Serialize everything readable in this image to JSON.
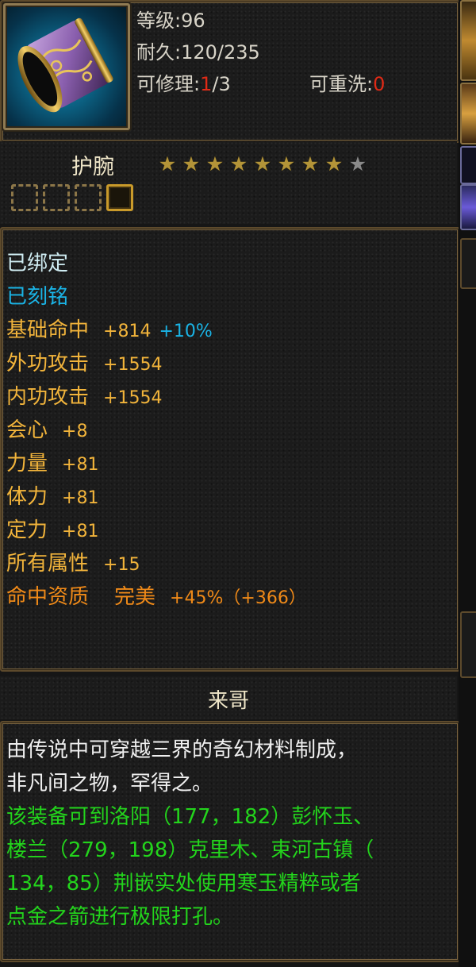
{
  "header": {
    "level_label": "等级",
    "level_value": "96",
    "durability_label": "耐久",
    "durability_value": "120/235",
    "repairable_label": "可修理",
    "repairable_current": "1",
    "repairable_total": "/3",
    "rewashable_label": "可重洗",
    "rewashable_value": "0"
  },
  "item": {
    "name": "护腕",
    "stars_total": 9,
    "stars_lit": 8,
    "sockets": [
      {
        "filled": false
      },
      {
        "filled": false
      },
      {
        "filled": false
      },
      {
        "filled": true
      }
    ]
  },
  "status": {
    "bound": "已绑定",
    "engraved": "已刻铭"
  },
  "attributes": [
    {
      "label": "基础命中",
      "value": "+814",
      "extra": "+10%"
    },
    {
      "label": "外功攻击",
      "value": "+1554"
    },
    {
      "label": "内功攻击",
      "value": "+1554"
    },
    {
      "label": "会心",
      "value": "+8"
    },
    {
      "label": "力量",
      "value": "+81"
    },
    {
      "label": "体力",
      "value": "+81"
    },
    {
      "label": "定力",
      "value": "+81"
    },
    {
      "label": "所有属性",
      "value": "+15"
    }
  ],
  "aptitude": {
    "label": "命中资质",
    "grade": "完美",
    "percent": "+45%",
    "open": "（",
    "bonus": "+366",
    "close": "）"
  },
  "author": "来哥",
  "description": {
    "lines_white": [
      "由传说中可穿越三界的奇幻材料制成，",
      "非凡间之物，罕得之。"
    ],
    "lines_green": [
      "该装备可到洛阳（177，182）彭怀玉、",
      "楼兰（279，198）克里木、束河古镇（",
      "134，85）荆嵌实处使用寒玉精粹或者",
      "点金之箭进行极限打孔。"
    ]
  },
  "colors": {
    "frame": "#5d4a2c",
    "gold": "#f2b43b",
    "orange": "#f08a18",
    "cyan": "#1ab4e6",
    "green": "#23d41c",
    "red": "#e02a16"
  }
}
